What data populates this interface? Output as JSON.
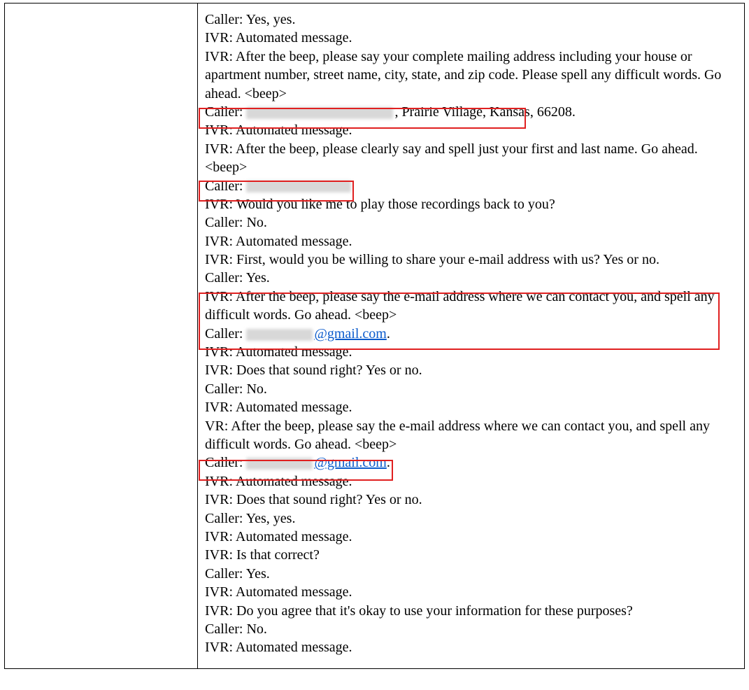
{
  "transcript": {
    "lines": [
      {
        "speaker": "Caller",
        "text": "Yes, yes."
      },
      {
        "speaker": "IVR",
        "text": "Automated message."
      },
      {
        "speaker": "IVR",
        "text": "After the beep, please say your complete mailing address including your house or apartment number, street name, city, state, and zip code. Please spell any difficult words. Go ahead. <beep>"
      },
      {
        "speaker": "Caller",
        "redacted": true,
        "redact_width": 210,
        "text": ", Prairie Village, Kansas, 66208."
      },
      {
        "speaker": "IVR",
        "text": "Automated message."
      },
      {
        "speaker": "IVR",
        "text": "After the beep, please clearly say and spell just your first and last name. Go ahead. <beep>"
      },
      {
        "speaker": "Caller",
        "redacted": true,
        "redact_width": 150,
        "text": ""
      },
      {
        "speaker": "IVR",
        "text": "Would you like me to play those recordings back to you?"
      },
      {
        "speaker": "Caller",
        "text": "No."
      },
      {
        "speaker": "IVR",
        "text": "Automated message."
      },
      {
        "speaker": "IVR",
        "text": "First, would you be willing to share your e-mail address with us? Yes or no."
      },
      {
        "speaker": "Caller",
        "text": "Yes."
      },
      {
        "speaker": "IVR",
        "text": "After the beep, please say the e-mail address where we can contact you, and spell any difficult words. Go ahead. <beep>"
      },
      {
        "speaker": "Caller",
        "redacted": true,
        "redact_width": 95,
        "email_suffix": "@gmail.com",
        "trailing_period": "."
      },
      {
        "speaker": "IVR",
        "text": "Automated message."
      },
      {
        "speaker": "IVR",
        "text": "Does that sound right? Yes or no."
      },
      {
        "speaker": "Caller",
        "text": "No."
      },
      {
        "speaker": "IVR",
        "text": "Automated message."
      },
      {
        "speaker": "VR",
        "text": "After the beep, please say the e-mail address where we can contact you, and spell any difficult words. Go ahead. <beep>"
      },
      {
        "speaker": "Caller",
        "redacted": true,
        "redact_width": 95,
        "email_suffix": "@gmail.com",
        "trailing_period": "."
      },
      {
        "speaker": "IVR",
        "text": "Automated message."
      },
      {
        "speaker": "IVR",
        "text": "Does that sound right? Yes or no."
      },
      {
        "speaker": "Caller",
        "text": "Yes, yes."
      },
      {
        "speaker": "IVR",
        "text": "Automated message."
      },
      {
        "speaker": "IVR",
        "text": "Is that correct?"
      },
      {
        "speaker": "Caller",
        "text": "Yes."
      },
      {
        "speaker": "IVR",
        "text": "Automated message."
      },
      {
        "speaker": "IVR",
        "text": "Do you agree that it's okay to use your information for these purposes?"
      },
      {
        "speaker": "Caller",
        "text": "No."
      },
      {
        "speaker": "IVR",
        "text": "Automated message."
      }
    ]
  }
}
